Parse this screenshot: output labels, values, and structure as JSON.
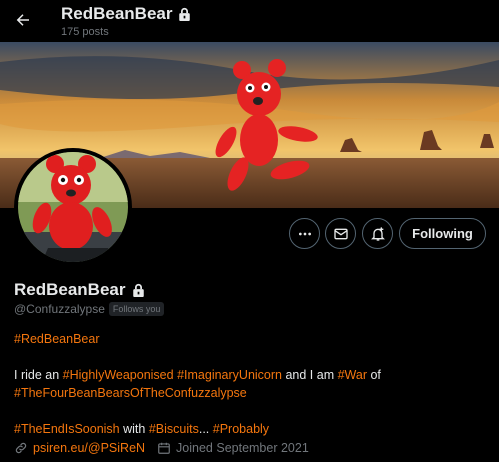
{
  "header": {
    "name": "RedBeanBear",
    "posts": "175 posts"
  },
  "actions": {
    "following_label": "Following"
  },
  "profile": {
    "display_name": "RedBeanBear",
    "handle": "@Confuzzalypse",
    "follows_you": "Follows you",
    "bio": {
      "line1": "#RedBeanBear",
      "line2_a": "I ride an ",
      "line2_tag1": "#HighlyWeaponised",
      "line2_b": " ",
      "line2_tag2": "#ImaginaryUnicorn",
      "line2_c": " and I am ",
      "line2_tag3": "#War",
      "line2_d": " of",
      "line3_tag": "#TheFourBeanBearsOfTheConfuzzalypse",
      "line4_tag1": "#TheEndIsSoonish",
      "line4_a": " with ",
      "line4_tag2": "#Biscuits",
      "line4_b": "... ",
      "line4_tag3": "#Probably"
    },
    "website": "psiren.eu/@PSiReN",
    "joined": "Joined September 2021"
  },
  "colors": {
    "accent": "#f4760e",
    "muted": "#71767b",
    "text": "#e7e9ea",
    "background": "#000000"
  },
  "icons": [
    "back-arrow-icon",
    "lock-icon",
    "more-icon",
    "mail-icon",
    "bell-plus-icon",
    "link-icon",
    "calendar-icon"
  ]
}
